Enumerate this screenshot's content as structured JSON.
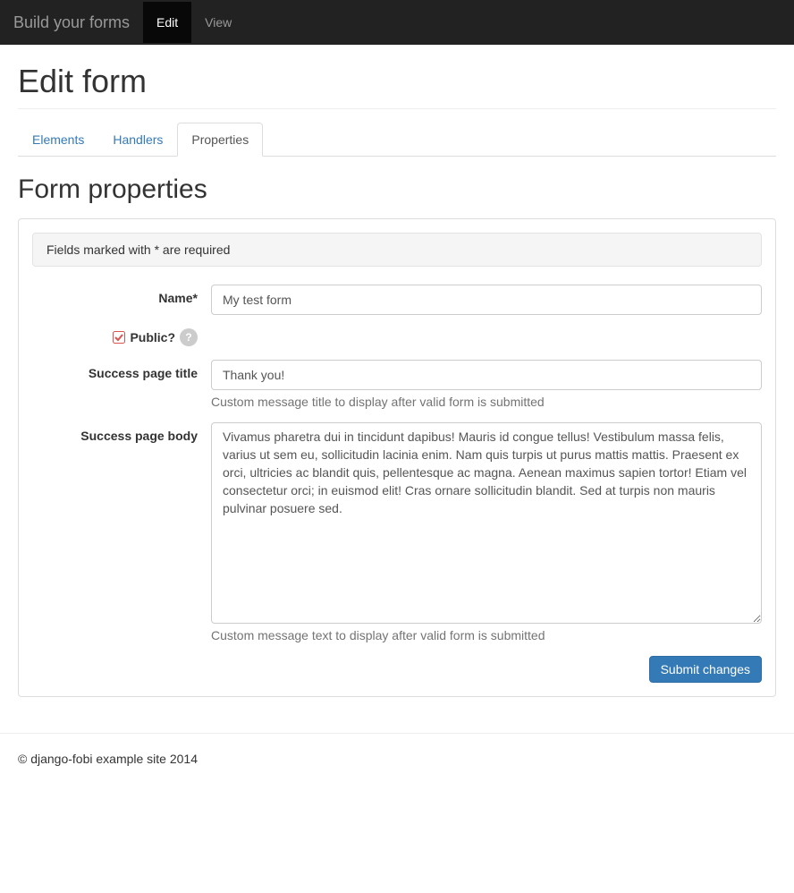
{
  "navbar": {
    "brand": "Build your forms",
    "items": [
      {
        "label": "Edit",
        "active": true
      },
      {
        "label": "View",
        "active": false
      }
    ]
  },
  "page": {
    "title": "Edit form"
  },
  "tabs": [
    {
      "label": "Elements",
      "active": false
    },
    {
      "label": "Handlers",
      "active": false
    },
    {
      "label": "Properties",
      "active": true
    }
  ],
  "section": {
    "title": "Form properties"
  },
  "notice": "Fields marked with * are required",
  "fields": {
    "name": {
      "label": "Name*",
      "value": "My test form"
    },
    "public": {
      "label": "Public?",
      "checked": true,
      "help_icon": "?"
    },
    "success_title": {
      "label": "Success page title",
      "value": "Thank you!",
      "help": "Custom message title to display after valid form is submitted"
    },
    "success_body": {
      "label": "Success page body",
      "value": "Vivamus pharetra dui in tincidunt dapibus! Mauris id congue tellus! Vestibulum massa felis, varius ut sem eu, sollicitudin lacinia enim. Nam quis turpis ut purus mattis mattis. Praesent ex orci, ultricies ac blandit quis, pellentesque ac magna. Aenean maximus sapien tortor! Etiam vel consectetur orci; in euismod elit! Cras ornare sollicitudin blandit. Sed at turpis non mauris pulvinar posuere sed.",
      "help": "Custom message text to display after valid form is submitted"
    }
  },
  "submit": {
    "label": "Submit changes"
  },
  "footer": "© django-fobi example site 2014"
}
